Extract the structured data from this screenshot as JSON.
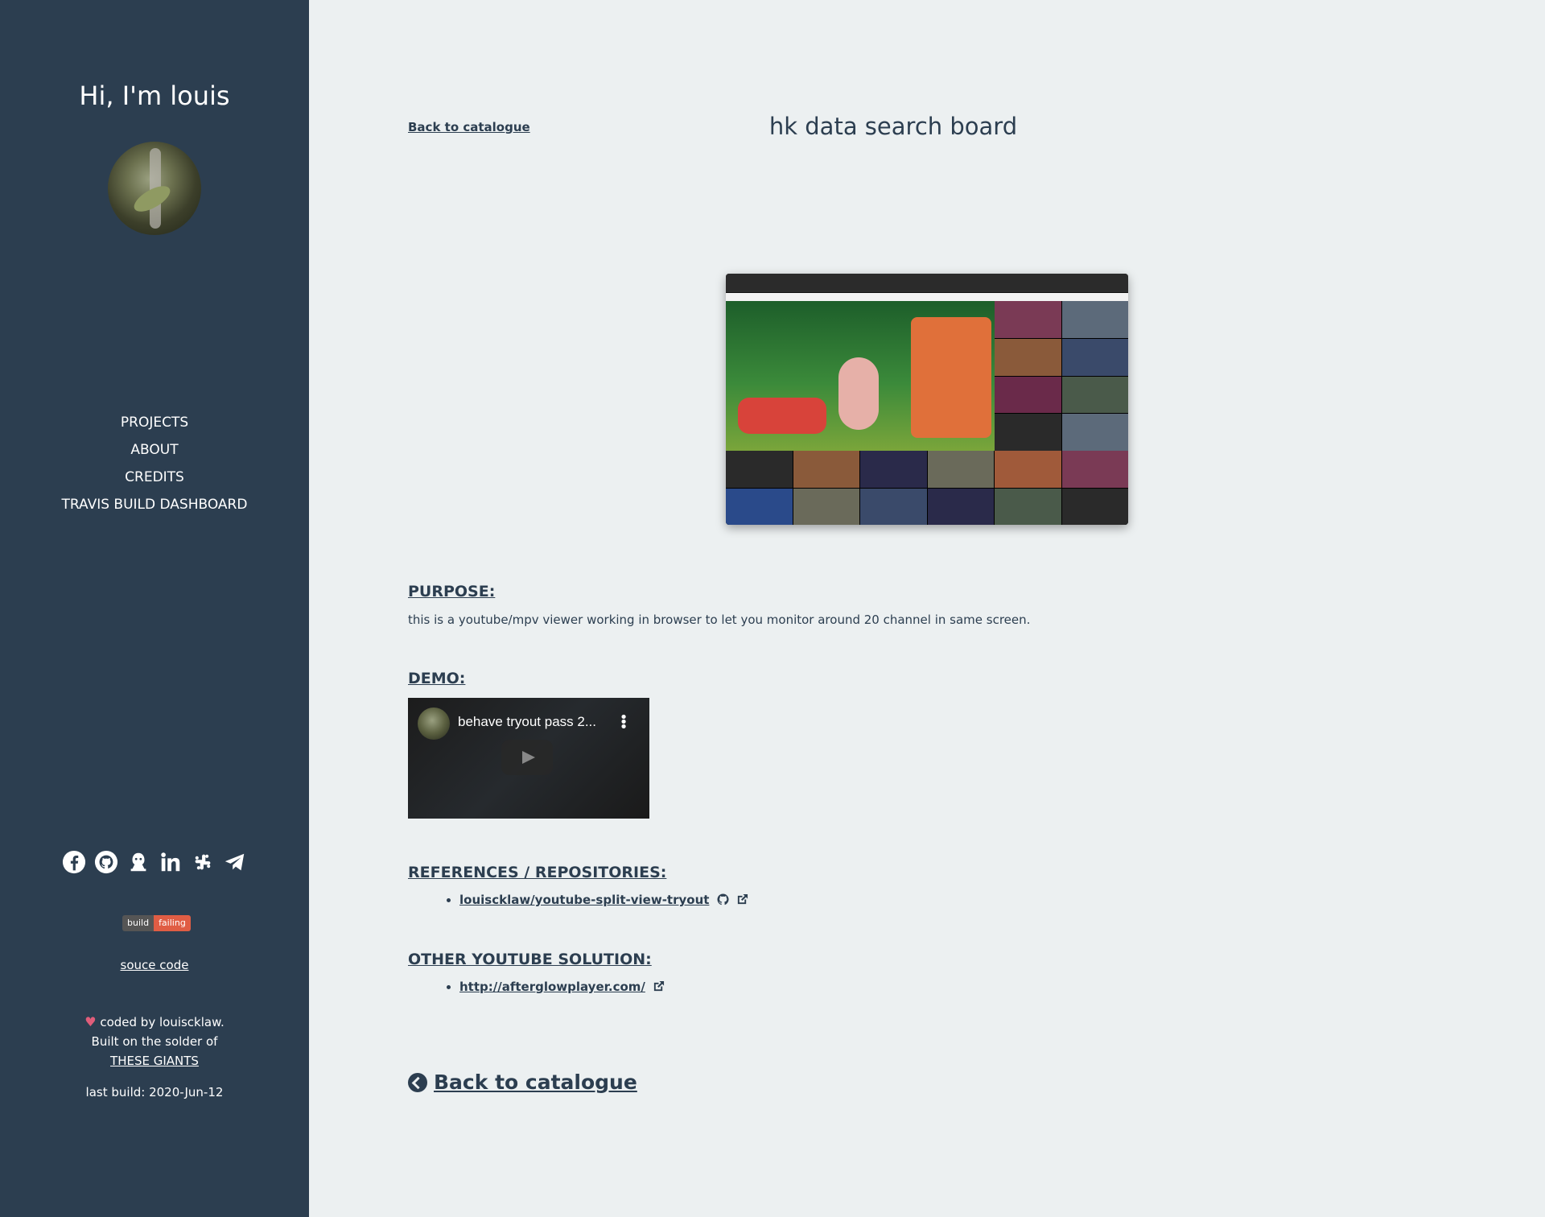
{
  "sidebar": {
    "greeting": "Hi, I'm louis",
    "nav": [
      "PROJECTS",
      "ABOUT",
      "CREDITS",
      "TRAVIS BUILD DASHBOARD"
    ],
    "social_icons": [
      "facebook-icon",
      "github-icon",
      "jenkins-icon",
      "linkedin-icon",
      "slack-icon",
      "telegram-icon"
    ],
    "badge": {
      "left": "build",
      "right": "failing",
      "right_color": "#e05d44"
    },
    "source_link": "souce code",
    "credits_line1": "coded by louiscklaw.",
    "credits_line2": "Built on the solder of",
    "credits_link": "THESE GIANTS",
    "last_build": "last build: 2020-Jun-12"
  },
  "main": {
    "back_link_top": "Back to catalogue",
    "title": "hk data search board",
    "purpose_heading": "PURPOSE:",
    "purpose_text": "this is a youtube/mpv viewer working in browser to let you monitor around 20 channel in same screen.",
    "demo_heading": "DEMO:",
    "video_title": "behave tryout pass 2...",
    "references_heading": "REFERENCES / REPOSITORIES:",
    "references": [
      "louiscklaw/youtube-split-view-tryout"
    ],
    "other_heading": "OTHER YOUTUBE SOLUTION:",
    "other_links": [
      "http://afterglowplayer.com/"
    ],
    "back_link_bottom": "Back to catalogue"
  },
  "colors": {
    "sidebar_bg": "#2c3e50",
    "main_bg": "#ecf0f1",
    "text": "#2c3e50"
  }
}
